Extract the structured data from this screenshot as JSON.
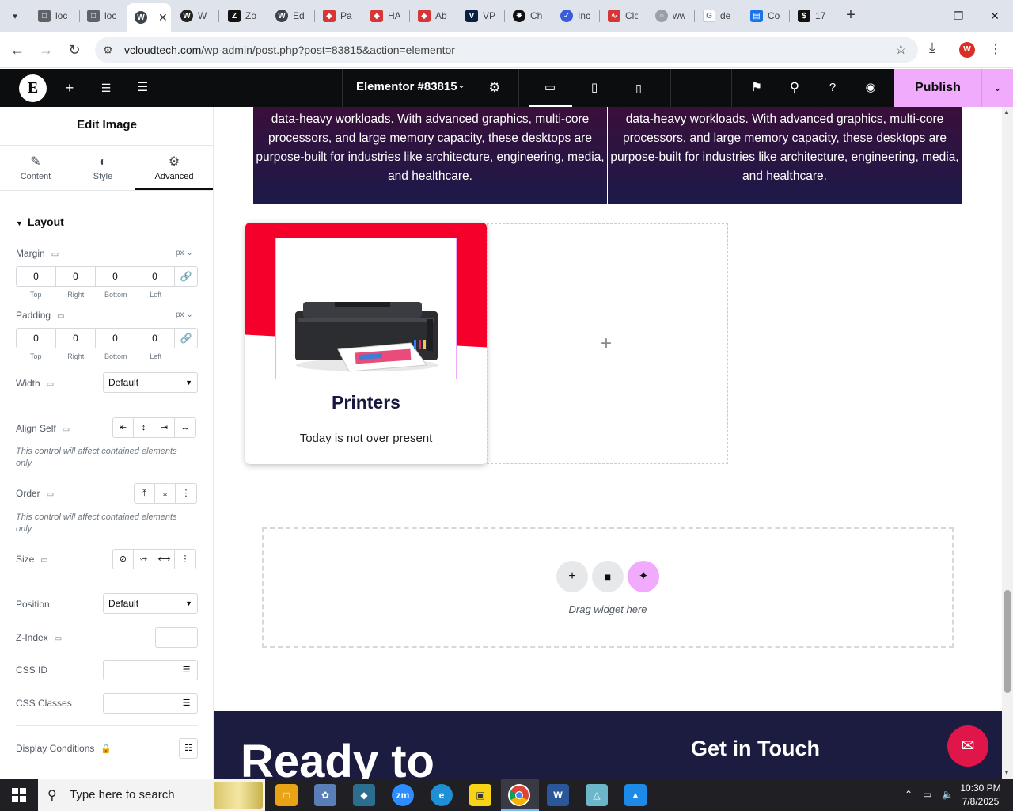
{
  "browser": {
    "tabs": [
      {
        "title": "loc",
        "icon": "loc-page-icon",
        "color": "#5f6368"
      },
      {
        "title": "loc",
        "icon": "loc-page-icon",
        "color": "#5f6368"
      },
      {
        "title": "",
        "icon": "wordpress-icon",
        "color": "#3c434a",
        "active": true
      },
      {
        "title": "W",
        "icon": "wordpress-icon",
        "color": "#222222"
      },
      {
        "title": "Zo",
        "icon": "zoho-icon",
        "color": "#111111"
      },
      {
        "title": "Ed",
        "icon": "wordpress-icon",
        "color": "#3c434a"
      },
      {
        "title": "Pa",
        "icon": "elementor-pa-icon",
        "color": "#d63638"
      },
      {
        "title": "HA",
        "icon": "happy-addons-icon",
        "color": "#d63638"
      },
      {
        "title": "Ab",
        "icon": "addons-icon",
        "color": "#d63638"
      },
      {
        "title": "VP",
        "icon": "vp-icon",
        "color": "#0a1f44"
      },
      {
        "title": "Ch",
        "icon": "chatgpt-icon",
        "color": "#111111"
      },
      {
        "title": "Inc",
        "icon": "inc-icon",
        "color": "#3b5bdb"
      },
      {
        "title": "Clo",
        "icon": "clo-icon",
        "color": "#d63638"
      },
      {
        "title": "ww",
        "icon": "loading-icon",
        "color": "#9aa0a6"
      },
      {
        "title": "de",
        "icon": "google-icon",
        "color": "#4285f4"
      },
      {
        "title": "Co",
        "icon": "forms-icon",
        "color": "#1a73e8"
      },
      {
        "title": "17",
        "icon": "dollar-icon",
        "color": "#111111"
      }
    ],
    "url_host": "vcloudtech.com",
    "url_path": "/wp-admin/post.php?post=83815&action=elementor",
    "profile_initial": "W"
  },
  "editor": {
    "document_title": "Elementor #83815",
    "publish_label": "Publish",
    "accent_color": "#f0abfc"
  },
  "panel": {
    "title": "Edit Image",
    "tabs": [
      {
        "label": "Content",
        "icon": "pencil-icon"
      },
      {
        "label": "Style",
        "icon": "half-circle-icon"
      },
      {
        "label": "Advanced",
        "icon": "gear-icon",
        "active": true
      }
    ],
    "section": "Layout",
    "margin": {
      "label": "Margin",
      "unit": "px",
      "values": [
        "0",
        "0",
        "0",
        "0"
      ]
    },
    "padding": {
      "label": "Padding",
      "unit": "px",
      "values": [
        "0",
        "0",
        "0",
        "0"
      ]
    },
    "dim_labels": [
      "Top",
      "Right",
      "Bottom",
      "Left"
    ],
    "width": {
      "label": "Width",
      "value": "Default"
    },
    "align_self": {
      "label": "Align Self"
    },
    "note": "This control will affect contained elements only.",
    "order": {
      "label": "Order"
    },
    "size": {
      "label": "Size"
    },
    "position": {
      "label": "Position",
      "value": "Default"
    },
    "zindex": {
      "label": "Z-Index",
      "value": ""
    },
    "css_id": {
      "label": "CSS ID",
      "value": ""
    },
    "css_classes": {
      "label": "CSS Classes",
      "value": ""
    },
    "display_conditions": {
      "label": "Display Conditions"
    }
  },
  "canvas": {
    "card_text": "data-heavy workloads. With advanced graphics, multi-core processors, and large memory capacity, these desktops are purpose-built for industries like architecture, engineering, media, and healthcare.",
    "printer_title": "Printers",
    "printer_subtitle": "Today is not over present",
    "drag_text": "Drag widget here",
    "footer_heading": "Ready to",
    "footer_contact": "Get in Touch"
  },
  "taskbar": {
    "search_placeholder": "Type here to search",
    "time": "10:30 PM",
    "date": "7/8/2025"
  }
}
